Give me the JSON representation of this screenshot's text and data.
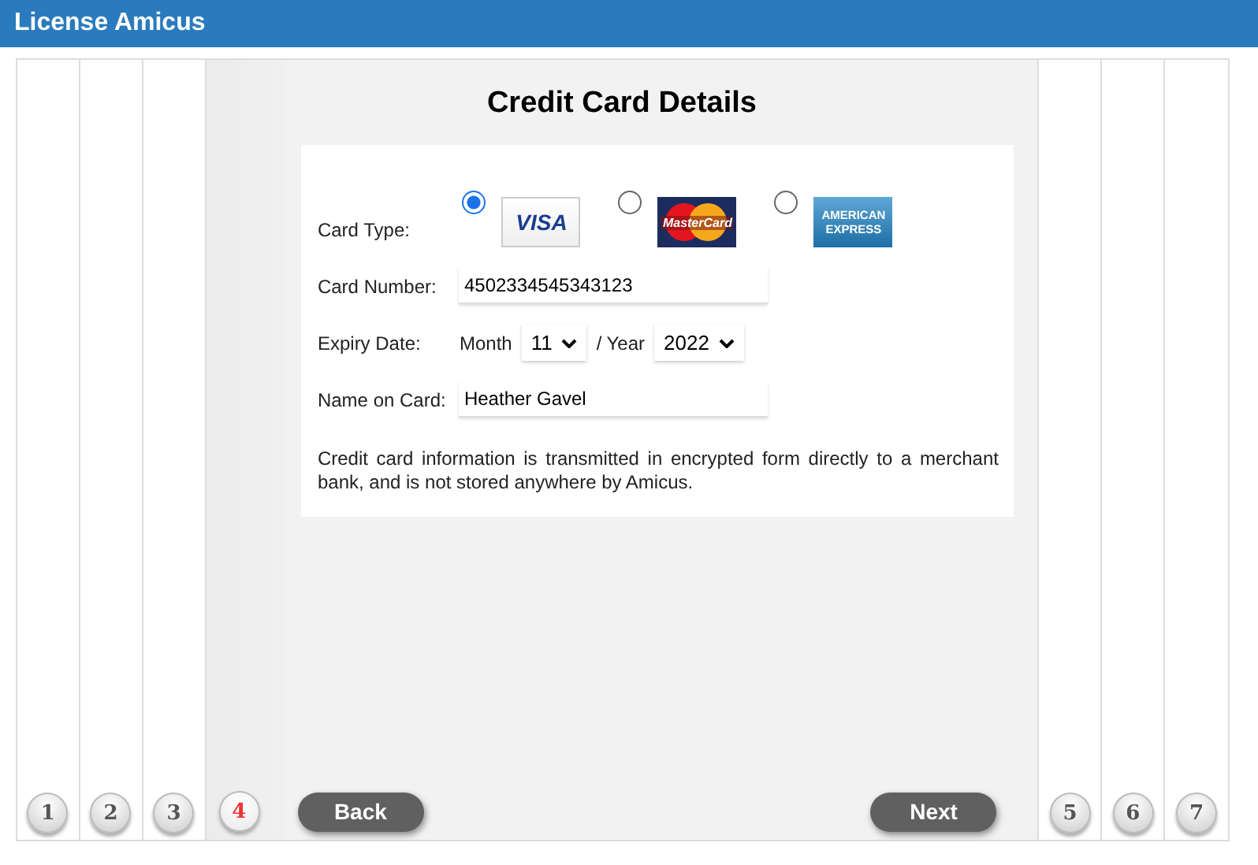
{
  "window": {
    "title": "License Amicus"
  },
  "steps": [
    {
      "label": "1",
      "selected": false
    },
    {
      "label": "2",
      "selected": false
    },
    {
      "label": "3",
      "selected": false
    },
    {
      "label": "4",
      "selected": true
    },
    {
      "label": "5",
      "selected": false
    },
    {
      "label": "6",
      "selected": false
    },
    {
      "label": "7",
      "selected": false
    }
  ],
  "form": {
    "heading": "Credit Card Details",
    "card_type": {
      "label": "Card Type:",
      "options": [
        {
          "kind": "visa",
          "selected": true,
          "logo_text": [
            "VISA"
          ]
        },
        {
          "kind": "mastercard",
          "selected": false,
          "logo_text": [
            "MasterCard"
          ]
        },
        {
          "kind": "amex",
          "selected": false,
          "logo_text": [
            "AMERICAN",
            "EXPRESS"
          ]
        }
      ]
    },
    "card_number": {
      "label": "Card Number:",
      "value": "4502334545343123"
    },
    "expiry": {
      "label": "Expiry Date:",
      "month_label": "Month",
      "month": "11",
      "year_label": "/ Year",
      "year": "2022"
    },
    "name_on_card": {
      "label": "Name on Card:",
      "value": "Heather Gavel"
    },
    "note": "Credit card information is transmitted in encrypted form directly to a merchant bank, and is not stored anywhere by Amicus."
  },
  "buttons": {
    "back": "Back",
    "next": "Next"
  }
}
